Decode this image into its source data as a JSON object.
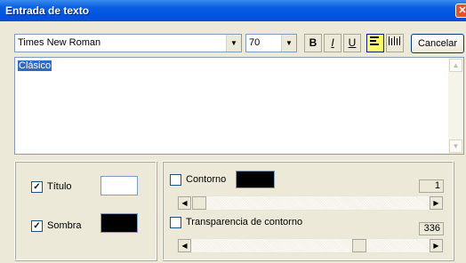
{
  "window": {
    "title": "Entrada de texto",
    "close_icon": "close-icon"
  },
  "toolbar": {
    "font_family": "Times New Roman",
    "font_size": "70",
    "bold_label": "B",
    "italic_label": "I",
    "underline_label": "U",
    "cancel_label": "Cancelar"
  },
  "text": {
    "value": "Clásico"
  },
  "left_panel": {
    "titulo_label": "Título",
    "titulo_checked": true,
    "titulo_color": "#ffffff",
    "sombra_label": "Sombra",
    "sombra_checked": true,
    "sombra_color": "#000000"
  },
  "right_panel": {
    "contorno_label": "Contorno",
    "contorno_checked": false,
    "contorno_color": "#000000",
    "contorno_value": "1",
    "transparencia_label": "Transparencia de contorno",
    "transparencia_checked": false,
    "transparencia_value": "336"
  }
}
